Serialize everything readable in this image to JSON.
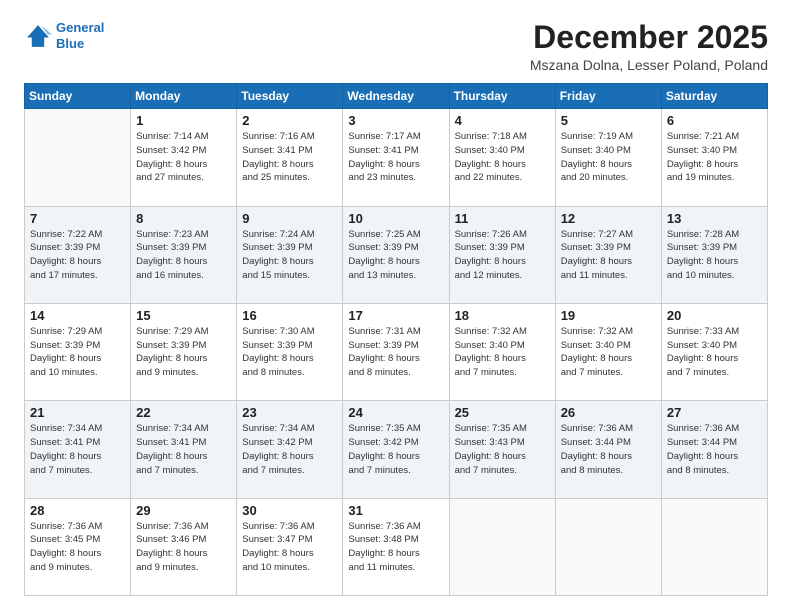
{
  "header": {
    "logo_line1": "General",
    "logo_line2": "Blue",
    "month": "December 2025",
    "location": "Mszana Dolna, Lesser Poland, Poland"
  },
  "weekdays": [
    "Sunday",
    "Monday",
    "Tuesday",
    "Wednesday",
    "Thursday",
    "Friday",
    "Saturday"
  ],
  "weeks": [
    [
      {
        "day": "",
        "info": ""
      },
      {
        "day": "1",
        "info": "Sunrise: 7:14 AM\nSunset: 3:42 PM\nDaylight: 8 hours\nand 27 minutes."
      },
      {
        "day": "2",
        "info": "Sunrise: 7:16 AM\nSunset: 3:41 PM\nDaylight: 8 hours\nand 25 minutes."
      },
      {
        "day": "3",
        "info": "Sunrise: 7:17 AM\nSunset: 3:41 PM\nDaylight: 8 hours\nand 23 minutes."
      },
      {
        "day": "4",
        "info": "Sunrise: 7:18 AM\nSunset: 3:40 PM\nDaylight: 8 hours\nand 22 minutes."
      },
      {
        "day": "5",
        "info": "Sunrise: 7:19 AM\nSunset: 3:40 PM\nDaylight: 8 hours\nand 20 minutes."
      },
      {
        "day": "6",
        "info": "Sunrise: 7:21 AM\nSunset: 3:40 PM\nDaylight: 8 hours\nand 19 minutes."
      }
    ],
    [
      {
        "day": "7",
        "info": "Sunrise: 7:22 AM\nSunset: 3:39 PM\nDaylight: 8 hours\nand 17 minutes."
      },
      {
        "day": "8",
        "info": "Sunrise: 7:23 AM\nSunset: 3:39 PM\nDaylight: 8 hours\nand 16 minutes."
      },
      {
        "day": "9",
        "info": "Sunrise: 7:24 AM\nSunset: 3:39 PM\nDaylight: 8 hours\nand 15 minutes."
      },
      {
        "day": "10",
        "info": "Sunrise: 7:25 AM\nSunset: 3:39 PM\nDaylight: 8 hours\nand 13 minutes."
      },
      {
        "day": "11",
        "info": "Sunrise: 7:26 AM\nSunset: 3:39 PM\nDaylight: 8 hours\nand 12 minutes."
      },
      {
        "day": "12",
        "info": "Sunrise: 7:27 AM\nSunset: 3:39 PM\nDaylight: 8 hours\nand 11 minutes."
      },
      {
        "day": "13",
        "info": "Sunrise: 7:28 AM\nSunset: 3:39 PM\nDaylight: 8 hours\nand 10 minutes."
      }
    ],
    [
      {
        "day": "14",
        "info": "Sunrise: 7:29 AM\nSunset: 3:39 PM\nDaylight: 8 hours\nand 10 minutes."
      },
      {
        "day": "15",
        "info": "Sunrise: 7:29 AM\nSunset: 3:39 PM\nDaylight: 8 hours\nand 9 minutes."
      },
      {
        "day": "16",
        "info": "Sunrise: 7:30 AM\nSunset: 3:39 PM\nDaylight: 8 hours\nand 8 minutes."
      },
      {
        "day": "17",
        "info": "Sunrise: 7:31 AM\nSunset: 3:39 PM\nDaylight: 8 hours\nand 8 minutes."
      },
      {
        "day": "18",
        "info": "Sunrise: 7:32 AM\nSunset: 3:40 PM\nDaylight: 8 hours\nand 7 minutes."
      },
      {
        "day": "19",
        "info": "Sunrise: 7:32 AM\nSunset: 3:40 PM\nDaylight: 8 hours\nand 7 minutes."
      },
      {
        "day": "20",
        "info": "Sunrise: 7:33 AM\nSunset: 3:40 PM\nDaylight: 8 hours\nand 7 minutes."
      }
    ],
    [
      {
        "day": "21",
        "info": "Sunrise: 7:34 AM\nSunset: 3:41 PM\nDaylight: 8 hours\nand 7 minutes."
      },
      {
        "day": "22",
        "info": "Sunrise: 7:34 AM\nSunset: 3:41 PM\nDaylight: 8 hours\nand 7 minutes."
      },
      {
        "day": "23",
        "info": "Sunrise: 7:34 AM\nSunset: 3:42 PM\nDaylight: 8 hours\nand 7 minutes."
      },
      {
        "day": "24",
        "info": "Sunrise: 7:35 AM\nSunset: 3:42 PM\nDaylight: 8 hours\nand 7 minutes."
      },
      {
        "day": "25",
        "info": "Sunrise: 7:35 AM\nSunset: 3:43 PM\nDaylight: 8 hours\nand 7 minutes."
      },
      {
        "day": "26",
        "info": "Sunrise: 7:36 AM\nSunset: 3:44 PM\nDaylight: 8 hours\nand 8 minutes."
      },
      {
        "day": "27",
        "info": "Sunrise: 7:36 AM\nSunset: 3:44 PM\nDaylight: 8 hours\nand 8 minutes."
      }
    ],
    [
      {
        "day": "28",
        "info": "Sunrise: 7:36 AM\nSunset: 3:45 PM\nDaylight: 8 hours\nand 9 minutes."
      },
      {
        "day": "29",
        "info": "Sunrise: 7:36 AM\nSunset: 3:46 PM\nDaylight: 8 hours\nand 9 minutes."
      },
      {
        "day": "30",
        "info": "Sunrise: 7:36 AM\nSunset: 3:47 PM\nDaylight: 8 hours\nand 10 minutes."
      },
      {
        "day": "31",
        "info": "Sunrise: 7:36 AM\nSunset: 3:48 PM\nDaylight: 8 hours\nand 11 minutes."
      },
      {
        "day": "",
        "info": ""
      },
      {
        "day": "",
        "info": ""
      },
      {
        "day": "",
        "info": ""
      }
    ]
  ]
}
